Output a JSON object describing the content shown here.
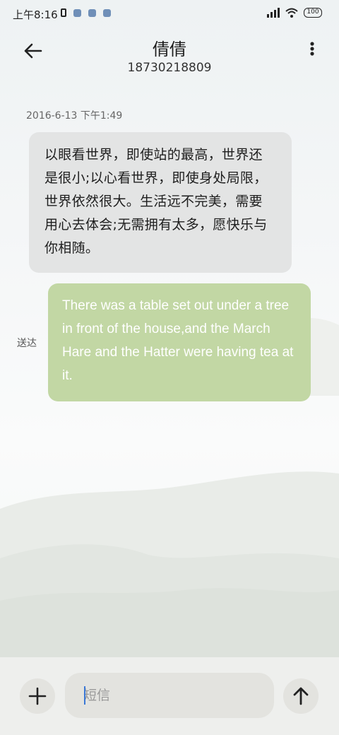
{
  "status_bar": {
    "time": "上午8:16",
    "battery": "100",
    "icons": [
      "vibrate-icon",
      "notification-icon",
      "notification-icon",
      "notification-icon",
      "signal-icon",
      "wifi-icon",
      "battery-icon"
    ]
  },
  "header": {
    "contact_name": "倩倩",
    "contact_number": "18730218809",
    "back_icon": "arrow-left-icon",
    "more_icon": "more-vertical-icon"
  },
  "conversation": {
    "timestamp": "2016-6-13 下午1:49",
    "messages": [
      {
        "direction": "incoming",
        "text": "以眼看世界，即使站的最高，世界还是很小;以心看世界，即使身处局限，世界依然很大。生活远不完美，需要用心去体会;无需拥有太多，愿快乐与你相随。"
      },
      {
        "direction": "outgoing",
        "status": "送达",
        "text": "There was a table set out under a tree in front of the house,and the March Hare and the Hatter were having tea at it."
      }
    ]
  },
  "composer": {
    "placeholder": "短信",
    "value": "",
    "attach_icon": "plus-icon",
    "send_icon": "arrow-up-icon"
  },
  "colors": {
    "incoming_bubble": "#e3e4e4",
    "outgoing_bubble": "#c2d7a4",
    "outgoing_text": "#ffffff"
  }
}
